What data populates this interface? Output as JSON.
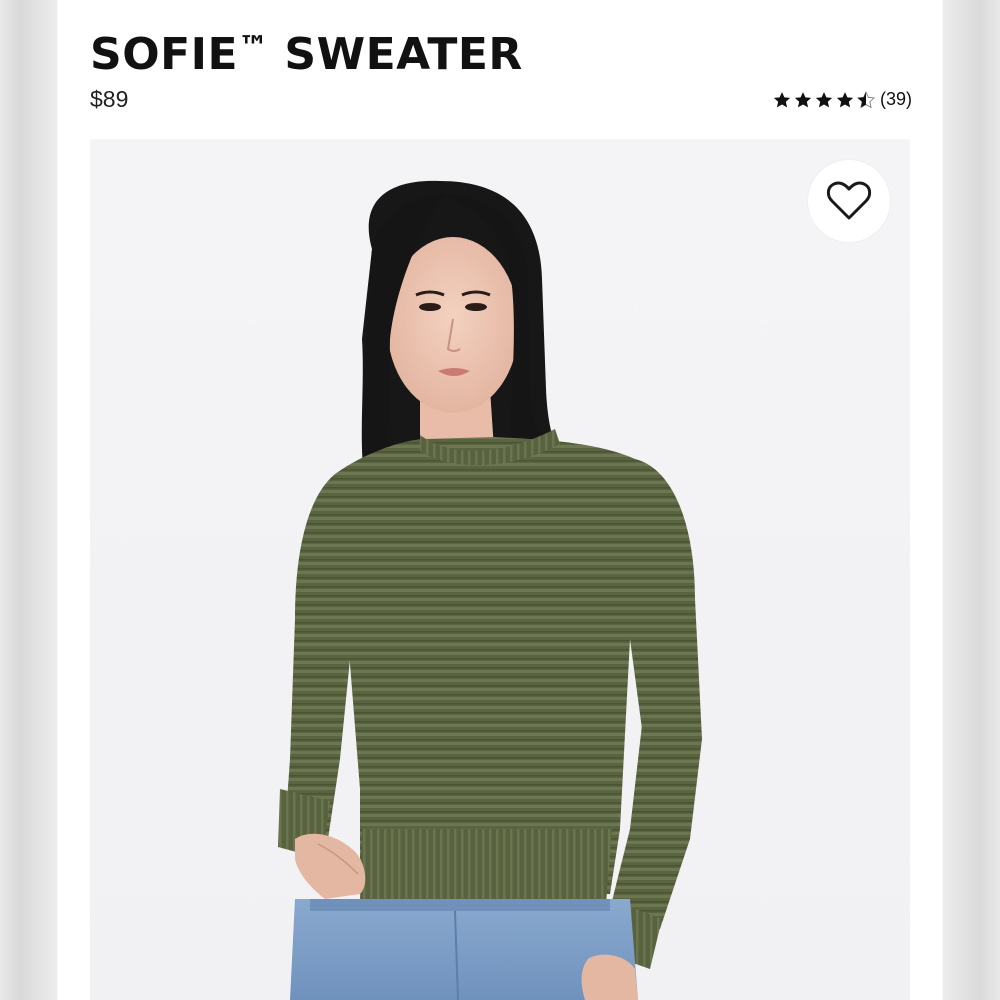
{
  "product": {
    "name": "SOFIE",
    "trademark": "™",
    "name_suffix": "SWEATER",
    "price": "$89",
    "rating": {
      "stars": 4.5,
      "count_label": "(39)"
    }
  },
  "icons": {
    "favorite": "heart-outline-icon",
    "star": "star-icon"
  },
  "colors": {
    "sweater": "#58623f",
    "jeans": "#7ea0c8",
    "hair": "#1a1a1a",
    "background": "#f2f2f4"
  }
}
